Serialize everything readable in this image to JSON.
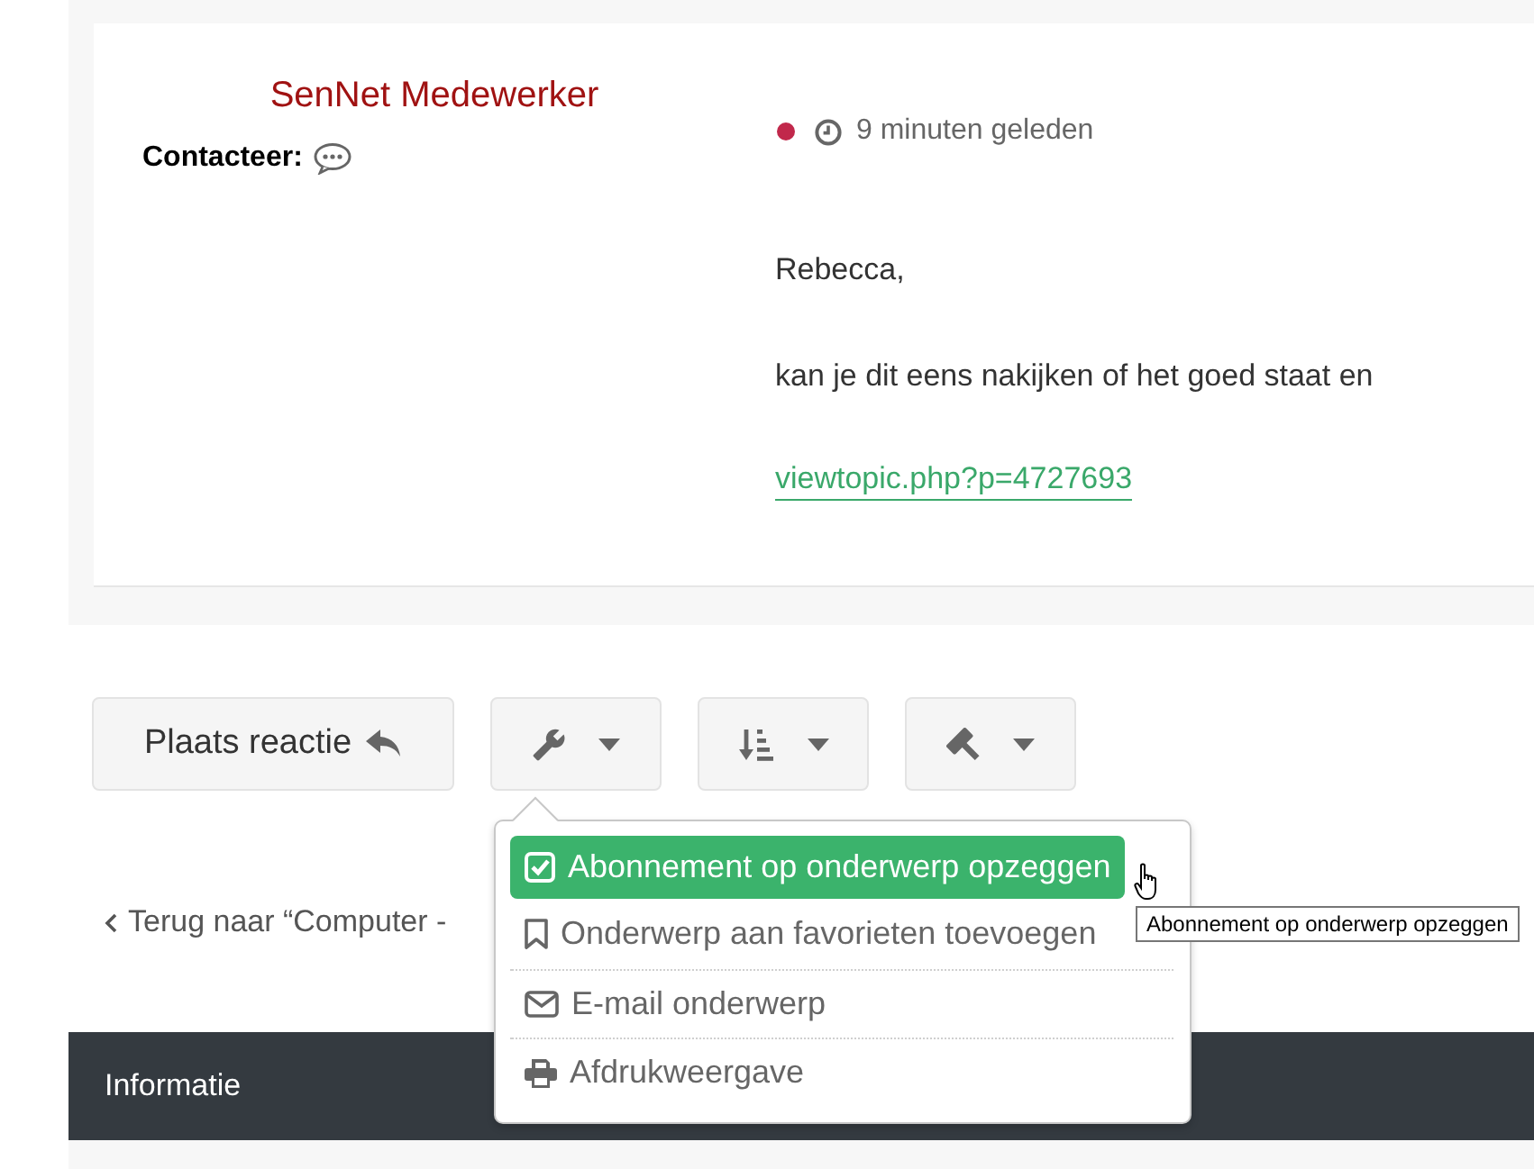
{
  "post": {
    "author": "SenNet Medewerker",
    "contact_label": "Contacteer:",
    "time": "9 minuten geleden",
    "paragraphs": [
      "Rebecca,",
      "kan je dit eens nakijken of het goed staat en"
    ],
    "link": "viewtopic.php?p=4727693"
  },
  "actions": {
    "reply_button": "Plaats reactie",
    "tool_buttons": [
      {
        "kind": "tools"
      },
      {
        "kind": "sort"
      },
      {
        "kind": "moderate"
      }
    ]
  },
  "tools_menu": {
    "items": [
      {
        "kind": "unsubscribe",
        "label": "Abonnement op onderwerp opzeggen",
        "selected": true
      },
      {
        "kind": "bookmark",
        "label": "Onderwerp aan favorieten toevoegen",
        "selected": false
      },
      {
        "kind": "email",
        "label": "E-mail onderwerp",
        "selected": false
      },
      {
        "kind": "print",
        "label": "Afdrukweergave",
        "selected": false
      }
    ],
    "tooltip": "Abonnement op onderwerp opzeggen"
  },
  "back_link": "Terug naar “Computer -",
  "info_bar": {
    "title": "Informatie"
  }
}
